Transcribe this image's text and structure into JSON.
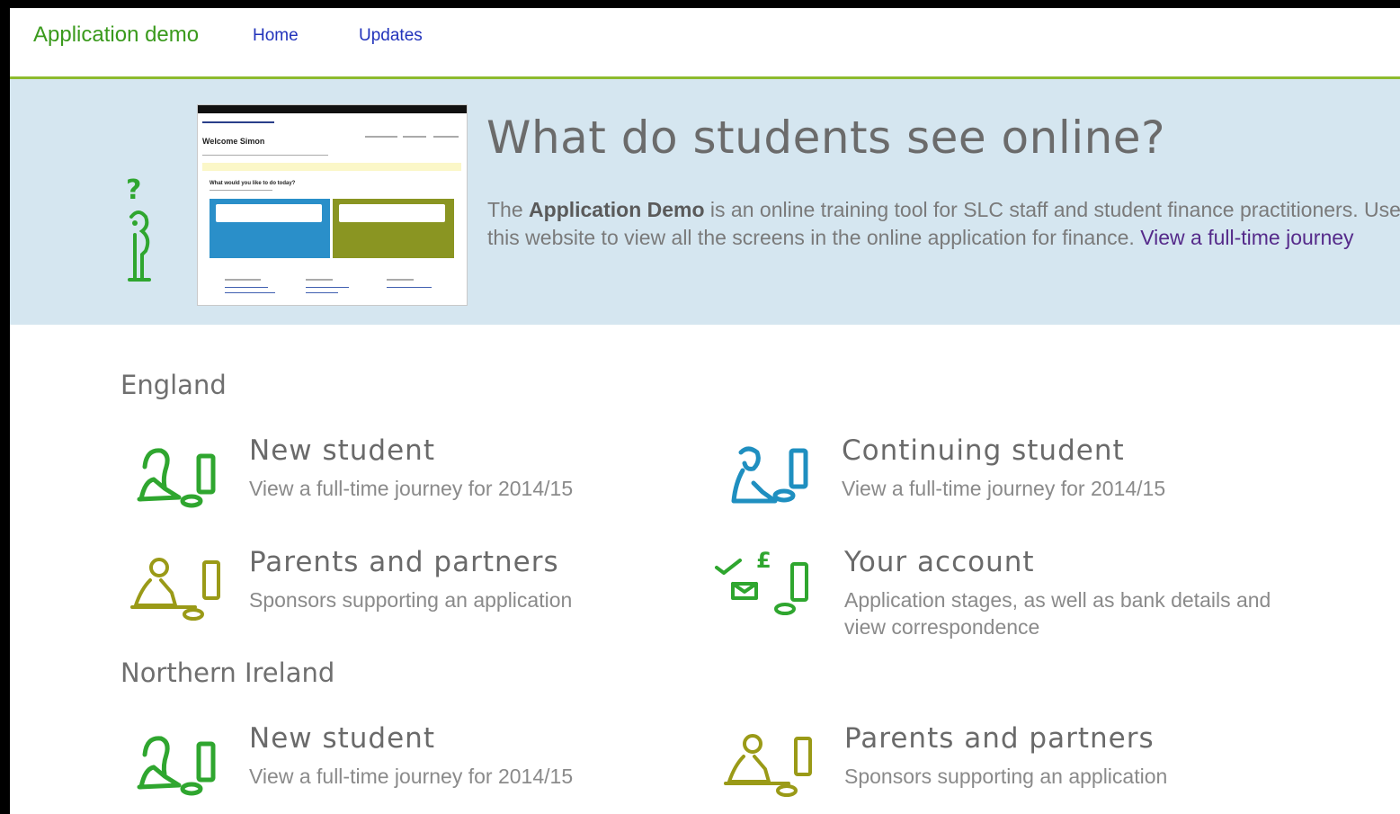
{
  "nav": {
    "brand": "Application demo",
    "links": [
      "Home",
      "Updates"
    ]
  },
  "hero": {
    "title": "What do students see online?",
    "desc_pre": "The ",
    "desc_bold": "Application Demo",
    "desc_mid": " is an online training tool for SLC staff and student finance practitioners. Use this website to view all the screens in the online application for finance. ",
    "desc_link": "View a full-time journey",
    "preview": {
      "welcome": "Welcome Simon",
      "question": "What would you like to do today?"
    }
  },
  "sections": [
    {
      "heading": "England",
      "cards": [
        {
          "title": "New student",
          "subtitle": "View a full-time journey for 2014/15",
          "icon": "new-student-icon"
        },
        {
          "title": "Continuing student",
          "subtitle": "View a full-time journey for 2014/15",
          "icon": "continuing-student-icon"
        },
        {
          "title": "Parents and partners",
          "subtitle": "Sponsors supporting an application",
          "icon": "parents-icon"
        },
        {
          "title": "Your account",
          "subtitle": "Application stages, as well as bank details and view correspondence",
          "icon": "account-icon"
        }
      ]
    },
    {
      "heading": "Northern Ireland",
      "cards": [
        {
          "title": "New student",
          "subtitle": "View a full-time journey for 2014/15",
          "icon": "new-student-icon"
        },
        {
          "title": "Parents and partners",
          "subtitle": "Sponsors supporting an application",
          "icon": "parents-icon"
        }
      ]
    }
  ],
  "colors": {
    "nav_border": "#8dbb2e",
    "hero_bg": "#d5e6f0",
    "brand": "#3a9a1c",
    "link": "#2233bb",
    "green_icon": "#2fa62f",
    "blue_icon": "#1f8fc0",
    "olive_icon": "#9a9a17"
  }
}
